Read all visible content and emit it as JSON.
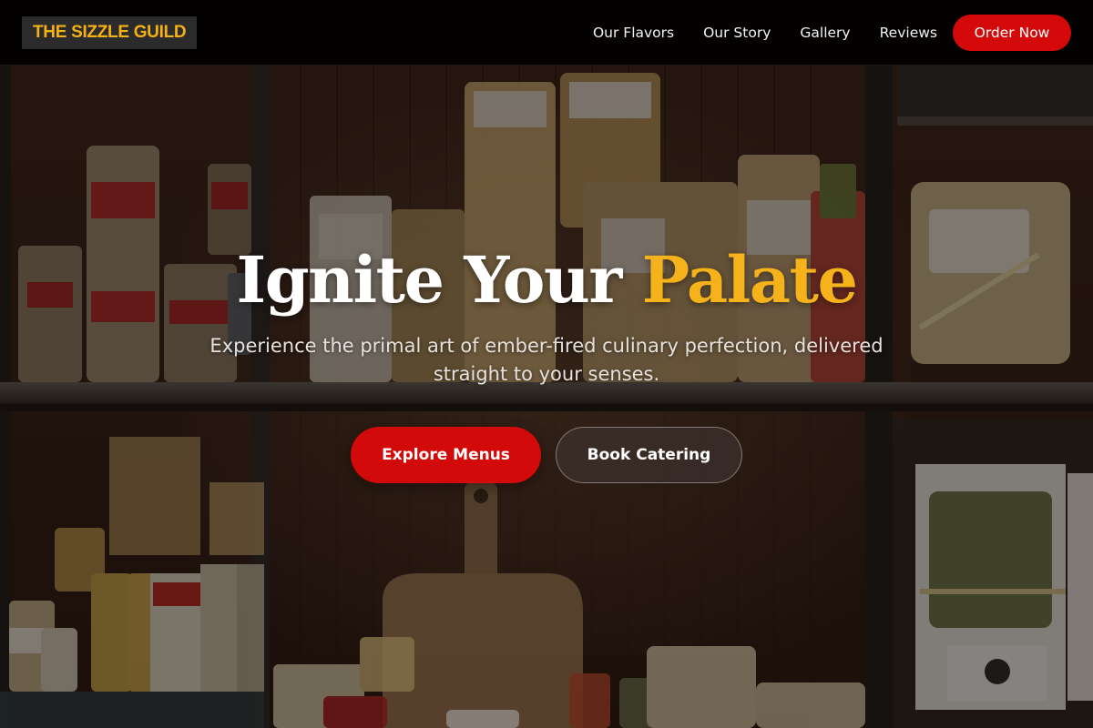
{
  "navbar": {
    "brand": "THE SIZZLE GUILD",
    "links": [
      "Our Flavors",
      "Our Story",
      "Gallery",
      "Reviews"
    ],
    "cta_label": "Order Now"
  },
  "hero": {
    "title_main": "Ignite Your ",
    "title_accent": "Palate",
    "subtitle": "Experience the primal art of ember-fired culinary perfection, delivered straight to your senses.",
    "primary_button": "Explore Menus",
    "secondary_button": "Book Catering"
  },
  "colors": {
    "accent": "#f5b21a",
    "brand_red": "#d20a0a",
    "nav_background": "#000000"
  }
}
